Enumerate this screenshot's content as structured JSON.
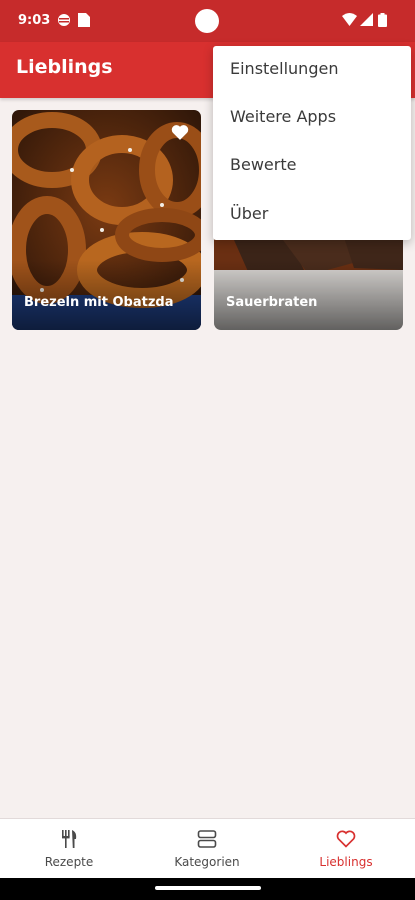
{
  "status_bar": {
    "time": "9:03"
  },
  "app_bar": {
    "title": "Lieblings"
  },
  "cards": [
    {
      "name": "Brezeln mit Obatzda",
      "favorite_icon": "heart-filled-icon"
    },
    {
      "name": "Sauerbraten"
    }
  ],
  "menu": {
    "items": [
      {
        "label": "Einstellungen"
      },
      {
        "label": "Weitere Apps"
      },
      {
        "label": "Bewerte"
      },
      {
        "label": "Über"
      }
    ]
  },
  "bottom_nav": {
    "items": [
      {
        "label": "Rezepte",
        "icon": "fork-knife-icon"
      },
      {
        "label": "Kategorien",
        "icon": "category-icon"
      },
      {
        "label": "Lieblings",
        "icon": "heart-outline-icon",
        "active": true
      }
    ]
  },
  "colors": {
    "accent": "#d8302f",
    "status_bar": "#c62b2b",
    "background": "#f6f0ef"
  }
}
